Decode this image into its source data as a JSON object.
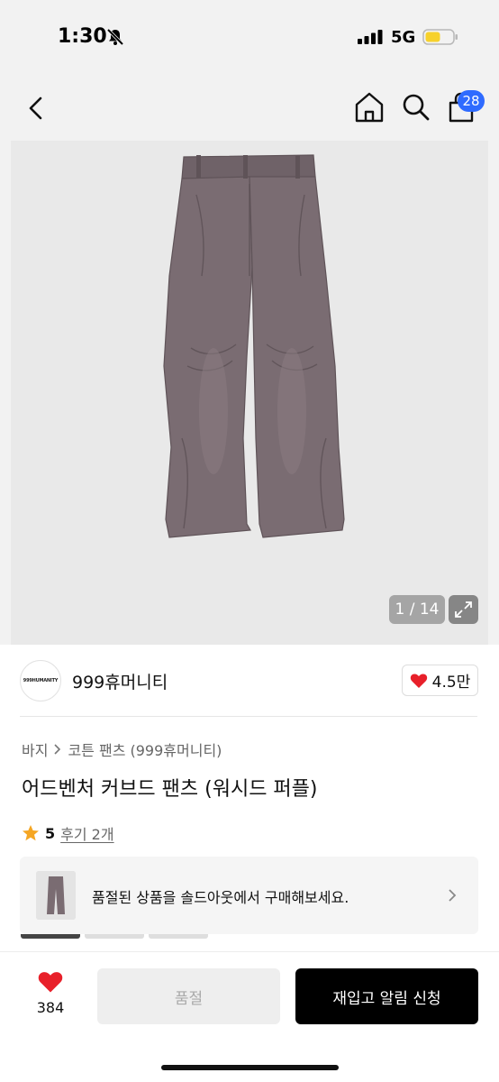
{
  "status_bar": {
    "time": "1:30",
    "network": "5G",
    "icons": [
      "bell-off-icon",
      "signal-icon",
      "battery-icon"
    ]
  },
  "header": {
    "icons": [
      "back-arrow-icon",
      "home-icon",
      "search-icon",
      "cart-icon"
    ],
    "cart_count": "28"
  },
  "gallery": {
    "counter": "1 / 14",
    "expand_icon": "expand-icon"
  },
  "brand": {
    "logo_text": "999HUMANITY",
    "name": "999휴머니티",
    "likes": "4.5만"
  },
  "breadcrumb": {
    "category": "바지",
    "subcategory": "코튼 팬츠 (999휴머니티)"
  },
  "product": {
    "title": "어드벤처 커브드 팬츠 (워시드 퍼플)"
  },
  "rating": {
    "score": "5",
    "reviews": "후기 2개"
  },
  "sold_banner": {
    "text": "품절된 상품을 솔드아웃에서 구매해보세요."
  },
  "bottom_bar": {
    "wish_count": "384",
    "soldout_label": "품절",
    "restock_label": "재입고 알림 신청"
  },
  "colors": {
    "accent_blue": "#2f6bff",
    "heart_red": "#e8202a",
    "star_orange": "#f5a623",
    "pants_purple": "#7a6c72"
  }
}
